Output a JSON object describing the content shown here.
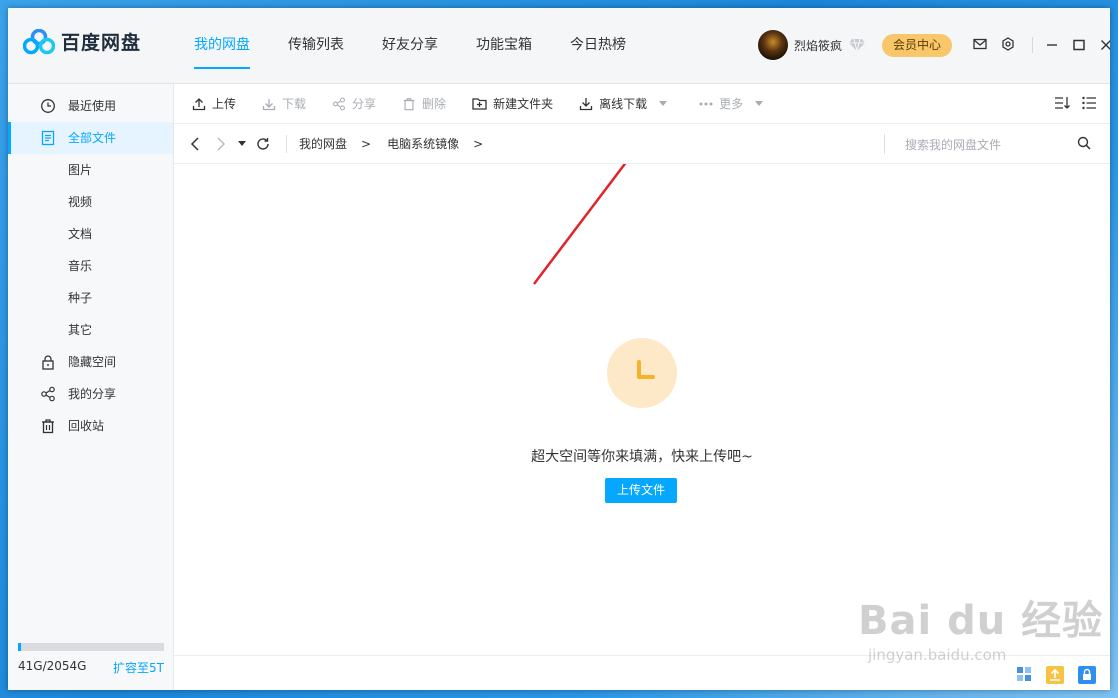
{
  "app": {
    "title": "百度网盘"
  },
  "nav": {
    "tabs": [
      {
        "label": "我的网盘",
        "active": true
      },
      {
        "label": "传输列表"
      },
      {
        "label": "好友分享"
      },
      {
        "label": "功能宝箱"
      },
      {
        "label": "今日热榜"
      }
    ]
  },
  "user": {
    "name": "烈焰筱疯",
    "vip_label": "会员中心"
  },
  "colors": {
    "accent": "#06a7ff",
    "vip": "#f7c76a",
    "empty_icon": "#fde9c7",
    "arrow": "#e0242a"
  },
  "sidebar": {
    "recent": "最近使用",
    "all_files": "全部文件",
    "sub": [
      "图片",
      "视频",
      "文档",
      "音乐",
      "种子",
      "其它"
    ],
    "hidden_space": "隐藏空间",
    "my_share": "我的分享",
    "recycle": "回收站",
    "quota": {
      "used_text": "41G/2054G",
      "expand": "扩容至5T",
      "used_fraction": 0.02
    }
  },
  "toolbar": {
    "upload": "上传",
    "download": "下载",
    "share": "分享",
    "delete": "删除",
    "new_folder": "新建文件夹",
    "offline_download": "离线下载",
    "more": "更多"
  },
  "breadcrumb": {
    "items": [
      "我的网盘",
      "电脑系统镜像"
    ],
    "sep": ">"
  },
  "search": {
    "placeholder": "搜索我的网盘文件"
  },
  "empty": {
    "message": "超大空间等你来填满，快来上传吧~",
    "button": "上传文件"
  },
  "watermark": {
    "main": "Bai du 经验",
    "sub": "jingyan.baidu.com"
  }
}
